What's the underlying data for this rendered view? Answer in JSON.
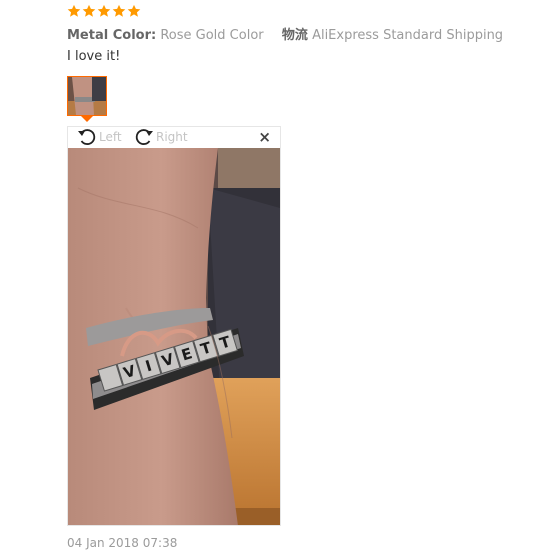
{
  "review": {
    "rating": 5,
    "max_rating": 5,
    "star_color": "#ff9a00",
    "attributes": [
      {
        "key": "Metal Color:",
        "value": "Rose Gold Color"
      },
      {
        "key": "物流",
        "value": "AliExpress Standard Shipping"
      }
    ],
    "text": "I love it!",
    "date": "04 Jan 2018 07:38"
  },
  "viewer": {
    "rotate_left_label": "Left",
    "rotate_right_label": "Right",
    "close_label": "×",
    "bracelet_letters": [
      "V",
      "I",
      "V",
      "E",
      "T",
      "T"
    ]
  },
  "colors": {
    "accent": "#ff6a00",
    "muted_text": "#9b9b9b",
    "key_text": "#666666"
  },
  "icons": {
    "rotate_left": "rotate-left-icon",
    "rotate_right": "rotate-right-icon",
    "close": "close-icon",
    "star": "star-icon"
  }
}
